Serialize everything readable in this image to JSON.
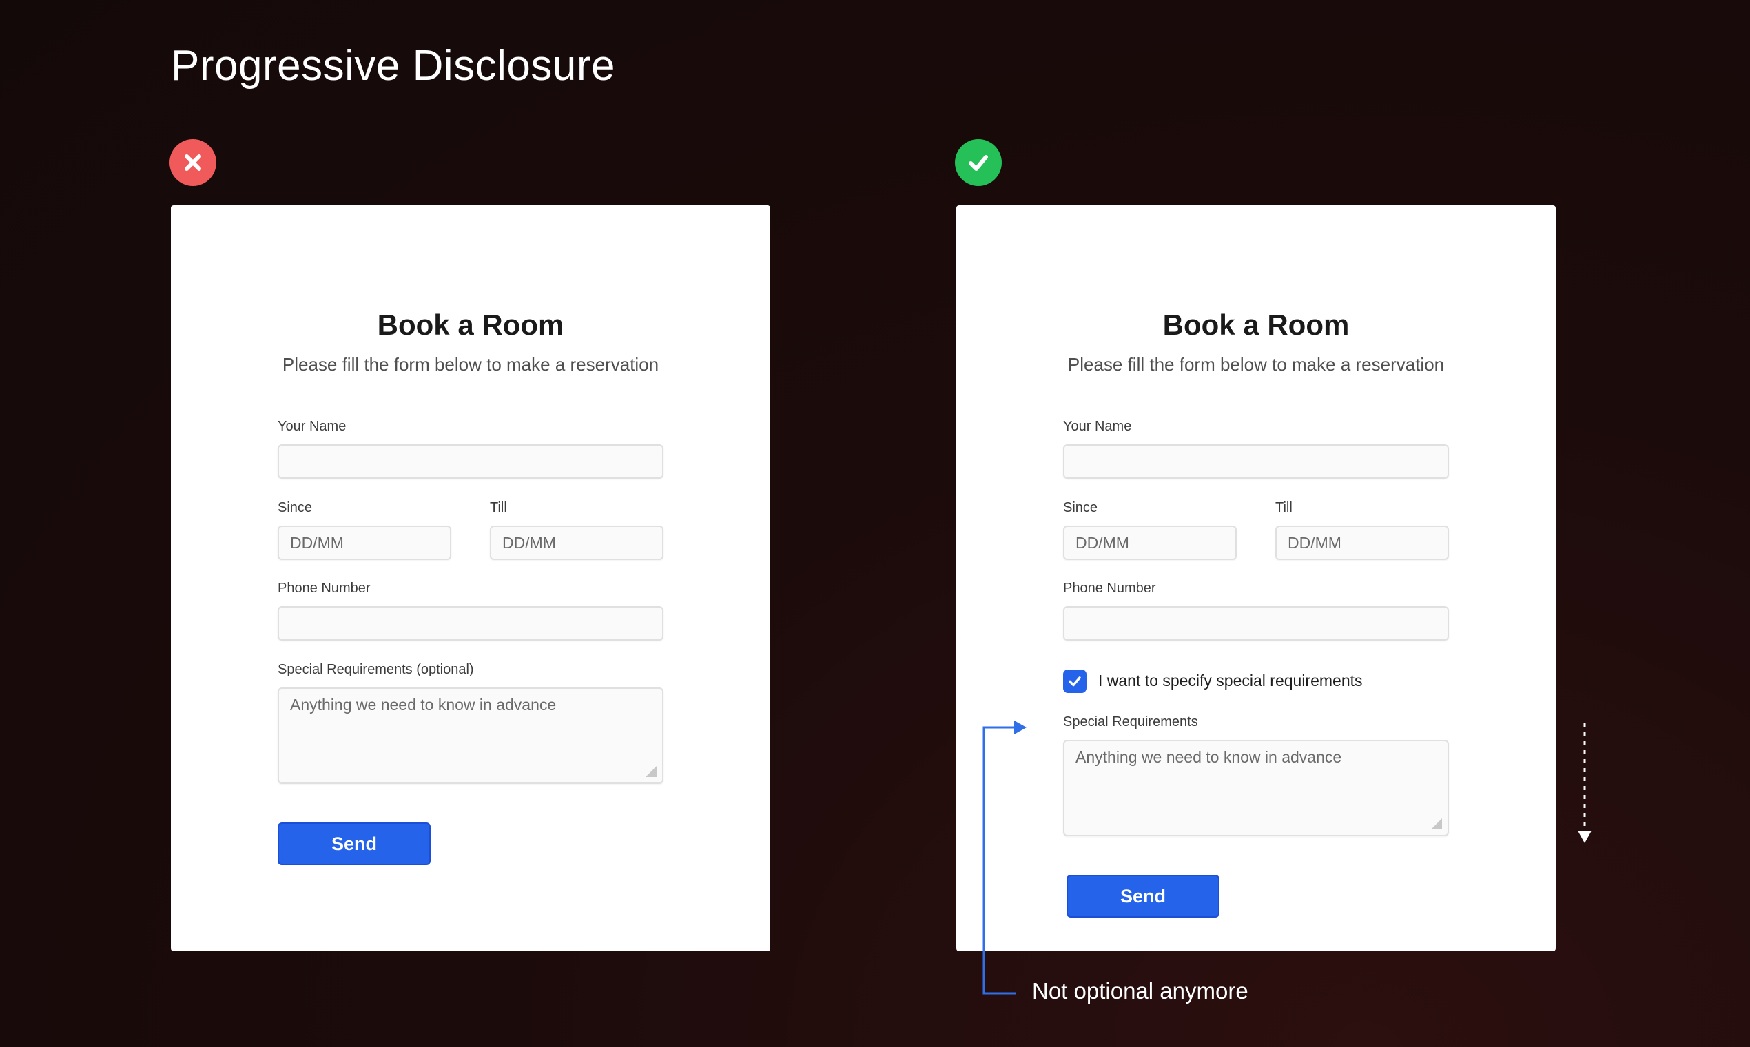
{
  "page": {
    "title": "Progressive Disclosure"
  },
  "bad_example": {
    "badge_icon": "x-icon",
    "badge_color": "#f05a5a",
    "form": {
      "title": "Book a Room",
      "subtitle": "Please fill the form below to make a reservation",
      "name_label": "Your Name",
      "since_label": "Since",
      "since_placeholder": "DD/MM",
      "till_label": "Till",
      "till_placeholder": "DD/MM",
      "phone_label": "Phone Number",
      "special_label": "Special Requirements (optional)",
      "special_placeholder": "Anything we need to know in advance",
      "send_label": "Send"
    }
  },
  "good_example": {
    "badge_icon": "check-icon",
    "badge_color": "#25c058",
    "form": {
      "title": "Book a Room",
      "subtitle": "Please fill the form below to make a reservation",
      "name_label": "Your Name",
      "since_label": "Since",
      "since_placeholder": "DD/MM",
      "till_label": "Till",
      "till_placeholder": "DD/MM",
      "phone_label": "Phone Number",
      "checkbox_label": "I want to specify special requirements",
      "checkbox_checked": true,
      "special_label": "Special Requirements",
      "special_placeholder": "Anything we need to know in advance",
      "send_label": "Send"
    }
  },
  "annotation": {
    "text": "Not optional anymore"
  },
  "colors": {
    "accent": "#2563eb",
    "annotation_line": "#2f6fe8"
  }
}
